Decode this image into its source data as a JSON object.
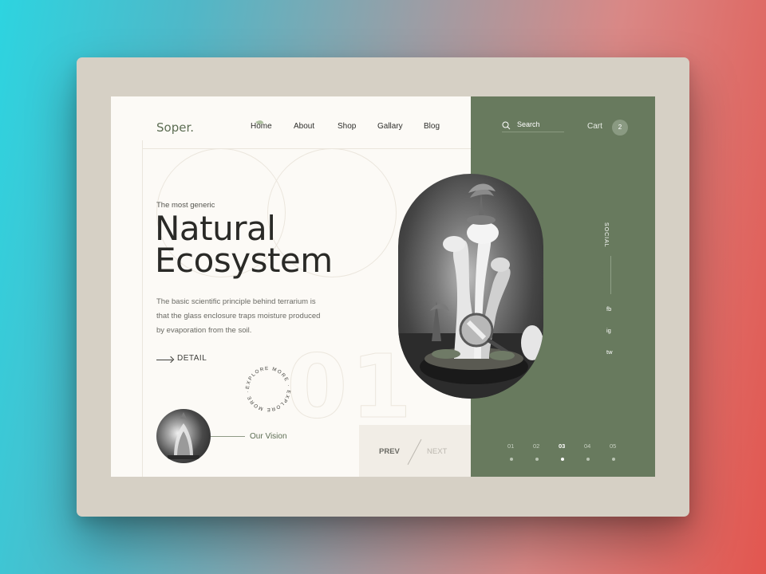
{
  "brand": {
    "name": "Soper."
  },
  "nav": {
    "items": [
      {
        "label": "Home",
        "active": true
      },
      {
        "label": "About"
      },
      {
        "label": "Shop"
      },
      {
        "label": "Gallary"
      },
      {
        "label": "Blog"
      }
    ]
  },
  "search": {
    "label": "Search",
    "icon": "search-icon"
  },
  "cart": {
    "label": "Cart",
    "count": "2"
  },
  "hero": {
    "kicker": "The most generic",
    "title_line1": "Natural",
    "title_line2": "Ecosystem",
    "description": "The basic scientific principle behind terrarium is that the glass enclosure traps moisture produced by evaporation from the soil.",
    "detail_label": "DETAIL",
    "slide_number": "01"
  },
  "explore": {
    "circle_text": "EXPLORE MORE · EXPLORE MORE · "
  },
  "vision": {
    "label": "Our Vision"
  },
  "pager": {
    "prev": "PREV",
    "next": "NEXT"
  },
  "social": {
    "label": "SOCIAL",
    "links": [
      "fb",
      "ig",
      "tw"
    ]
  },
  "slides": {
    "items": [
      "01",
      "02",
      "03",
      "04",
      "05"
    ],
    "active_index": 2
  },
  "colors": {
    "accent_green": "#687a5e",
    "background": "#fcfaf6",
    "frame": "#d6d0c5",
    "text_dark": "#2a2a27"
  }
}
